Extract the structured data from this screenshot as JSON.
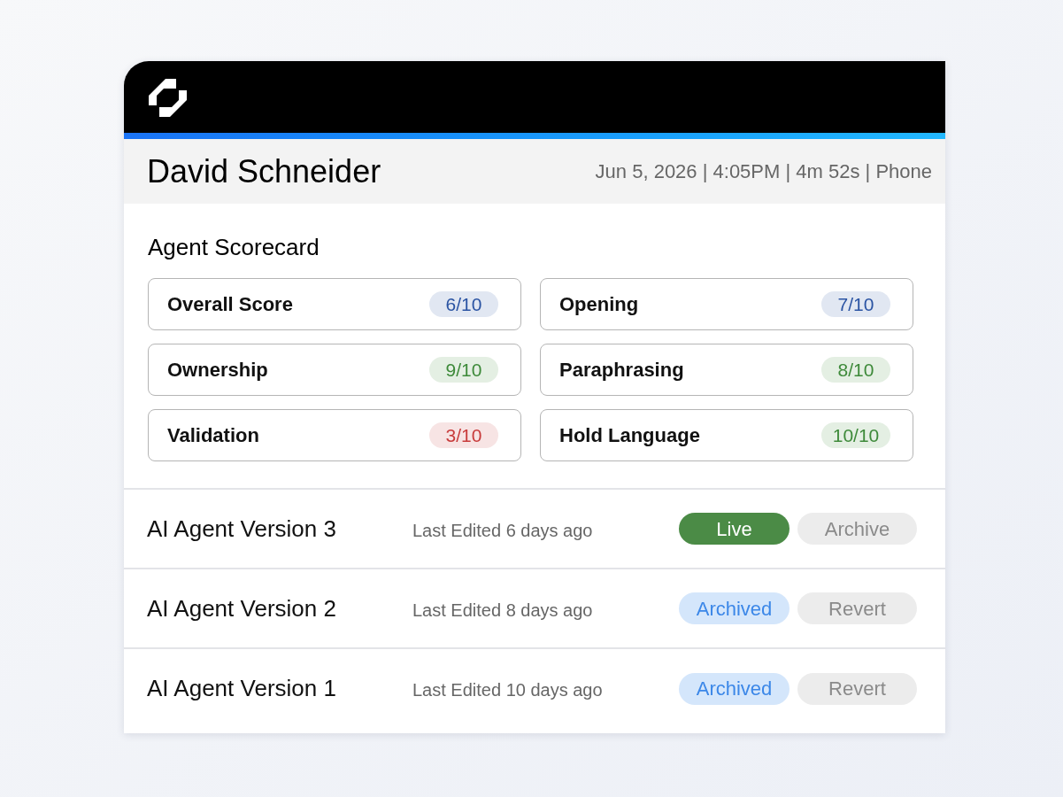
{
  "call": {
    "name": "David Schneider",
    "details": "Jun 5, 2026 | 4:05PM | 4m 52s | Phone"
  },
  "scorecard": {
    "title": "Agent Scorecard",
    "items": [
      {
        "label": "Overall Score",
        "score": "6/10",
        "color": "#2b54a3"
      },
      {
        "label": "Opening",
        "score": "7/10",
        "color": "#2b54a3"
      },
      {
        "label": "Ownership",
        "score": "9/10",
        "color": "#3e8a3a"
      },
      {
        "label": "Paraphrasing",
        "score": "8/10",
        "color": "#3e8a3a"
      },
      {
        "label": "Validation",
        "score": "3/10",
        "color": "#c83c3c"
      },
      {
        "label": "Hold Language",
        "score": "10/10",
        "color": "#3e8a3a"
      }
    ]
  },
  "versions": [
    {
      "name": "AI Agent Version 3",
      "edited": "Last Edited 6 days ago",
      "status": {
        "label": "Live",
        "kind": "live"
      },
      "action": "Archive"
    },
    {
      "name": "AI Agent Version 2",
      "edited": "Last Edited 8 days ago",
      "status": {
        "label": "Archived",
        "kind": "archived"
      },
      "action": "Revert"
    },
    {
      "name": "AI Agent Version 1",
      "edited": "Last Edited 10 days ago",
      "status": {
        "label": "Archived",
        "kind": "archived"
      },
      "action": "Revert"
    }
  ]
}
